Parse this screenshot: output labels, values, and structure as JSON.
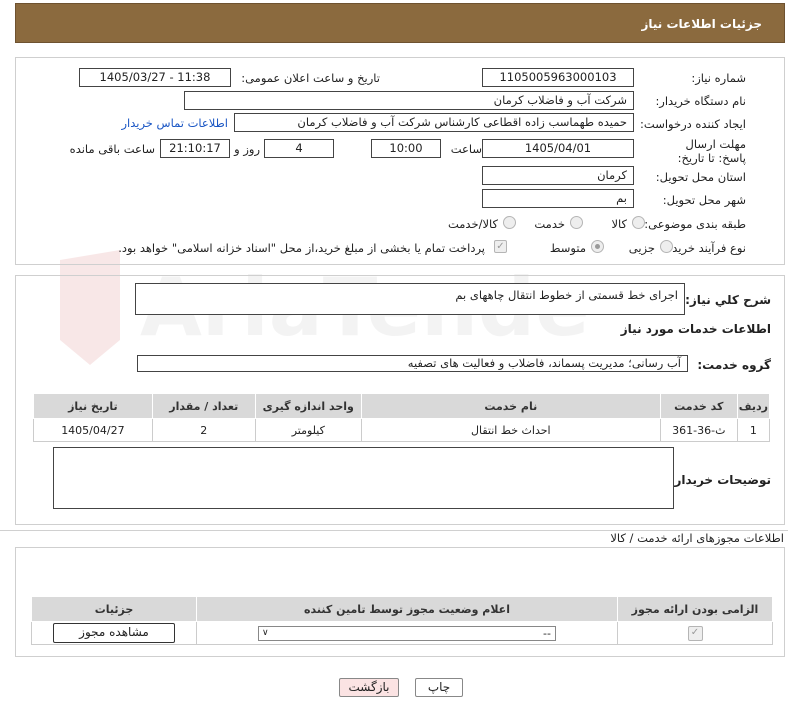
{
  "header": {
    "title": "جزئیات اطلاعات نیاز"
  },
  "form": {
    "need_number_label": "شماره نیاز:",
    "need_number": "1105005963000103",
    "announce_datetime_label": "تاریخ و ساعت اعلان عمومی:",
    "announce_datetime": "1405/03/27 - 11:38",
    "buyer_org_label": "نام دستگاه خریدار:",
    "buyer_org": "شرکت آب و فاضلاب کرمان",
    "requester_label": "ایجاد کننده درخواست:",
    "requester": "حمیده طهماسب زاده اقطاعی کارشناس شرکت آب و فاضلاب کرمان",
    "buyer_contact_link": "اطلاعات تماس خریدار",
    "deadline_label": "مهلت ارسال پاسخ: تا تاریخ:",
    "deadline_date": "1405/04/01",
    "time_label": "ساعت",
    "deadline_time": "10:00",
    "days_value": "4",
    "days_label": "روز و",
    "remaining_time": "21:10:17",
    "remaining_label": "ساعت باقی مانده",
    "province_label": "استان محل تحویل:",
    "province": "کرمان",
    "city_label": "شهر محل تحویل:",
    "city": "بم",
    "category_label": "طبقه بندی موضوعی:",
    "category_options": [
      "کالا",
      "خدمت",
      "کالا/خدمت"
    ],
    "process_label": "نوع فرآیند خرید :",
    "process_options": [
      "جزیی",
      "متوسط"
    ],
    "payment_note": "پرداخت تمام یا بخشی از مبلغ خرید،از محل \"اسناد خزانه اسلامی\" خواهد بود."
  },
  "description": {
    "label": "شرح کلي نياز:",
    "value": "اجرای خط قسمتی از خطوط انتقال چاههای بم"
  },
  "services": {
    "title": "اطلاعات خدمات مورد نیاز",
    "group_label": "گروه خدمت:",
    "group_value": "آب رسانی؛ مدیریت پسماند، فاضلاب و فعالیت های تصفیه",
    "columns": [
      "ردیف",
      "کد خدمت",
      "نام خدمت",
      "واحد اندازه گیری",
      "تعداد / مقدار",
      "تاریخ نیاز"
    ],
    "rows": [
      [
        "1",
        "ث-36-361",
        "احداث خط انتقال",
        "کیلومتر",
        "2",
        "1405/04/27"
      ]
    ]
  },
  "buyer_notes": {
    "label": "توضیحات خریدار:",
    "value": ""
  },
  "permits": {
    "title": "اطلاعات مجوزهای ارائه خدمت / کالا",
    "columns": [
      "الزامی بودن ارائه مجوز",
      "اعلام وضعیت مجوز توسط تامین کننده",
      "جزئیات"
    ],
    "select_value": "--",
    "view_button": "مشاهده مجوز"
  },
  "buttons": {
    "print": "چاپ",
    "back": "بازگشت"
  },
  "colors": {
    "header": "#8b6a3e",
    "link": "#1a56c4",
    "back_button": "#fbe3e3"
  }
}
